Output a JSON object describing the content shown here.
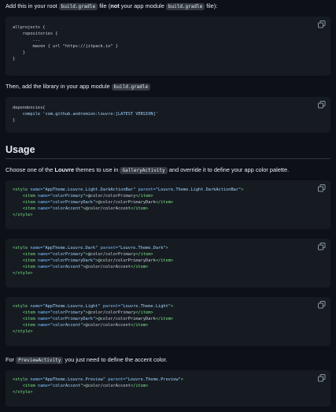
{
  "intro": {
    "p1_a": "Add this in your root",
    "p1_code1": "build.gradle",
    "p1_b": "file (",
    "p1_bold": "not",
    "p1_c": "your app module",
    "p1_code2": "build.gradle",
    "p1_d": "file):"
  },
  "code1": [
    "allprojects {",
    "    repositories {",
    "        ...",
    "        maven { url \"https://jitpack.io\" }",
    "    }",
    "}"
  ],
  "p2": {
    "a": "Then, add the library in your app module",
    "code": "build.gradle"
  },
  "code2": [
    "dependencies{",
    "    compile 'com.github.andremion:louvre:[LATEST VERSION]'",
    "}"
  ],
  "usage_heading": "Usage",
  "p3": {
    "a": "Choose one of the",
    "bold": "Louvre",
    "b": "themes to use in",
    "code": "GalleryActivity",
    "c": "and override it to define your app color palette."
  },
  "style_blocks": [
    {
      "name": "\"AppTheme.Louvre.Light.DarkActionBar\"",
      "parent": "\"Louvre.Theme.Light.DarkActionBar\"",
      "items": [
        {
          "n": "\"colorPrimary\"",
          "v": "@color/colorPrimary"
        },
        {
          "n": "\"colorPrimaryDark\"",
          "v": "@color/colorPrimaryDark"
        },
        {
          "n": "\"colorAccent\"",
          "v": "@color/colorAccent"
        }
      ]
    },
    {
      "name": "\"AppTheme.Louvre.Dark\"",
      "parent": "\"Louvre.Theme.Dark\"",
      "items": [
        {
          "n": "\"colorPrimary\"",
          "v": "@color/colorPrimary"
        },
        {
          "n": "\"colorPrimaryDark\"",
          "v": "@color/colorPrimaryDark"
        },
        {
          "n": "\"colorAccent\"",
          "v": "@color/colorAccent"
        }
      ]
    },
    {
      "name": "\"AppTheme.Louvre.Light\"",
      "parent": "\"Louvre.Theme.Light\"",
      "items": [
        {
          "n": "\"colorPrimary\"",
          "v": "@color/colorPrimary"
        },
        {
          "n": "\"colorPrimaryDark\"",
          "v": "@color/colorPrimaryDark"
        },
        {
          "n": "\"colorAccent\"",
          "v": "@color/colorAccent"
        }
      ]
    }
  ],
  "p4": {
    "a": "For",
    "code": "PreviewActivity",
    "b": "you just need to define the accent color."
  },
  "style_preview": {
    "name": "\"AppTheme.Louvre.Preview\"",
    "parent": "\"Louvre.Theme.Preview\"",
    "items": [
      {
        "n": "\"colorAccent\"",
        "v": "@color/colorAccent"
      }
    ]
  },
  "syntax": {
    "open": "<style",
    "name_attr": "name=",
    "parent_attr": "parent=",
    "gt": ">",
    "item_open": "<item",
    "item_close": "</item>",
    "style_close": "</style>"
  },
  "colors": {
    "bg": "#0d1117",
    "block": "#161b22",
    "tag": "#7ee787",
    "attr": "#79c0ff",
    "string": "#a5d6ff"
  },
  "icons": {
    "copy": "copy-icon"
  }
}
